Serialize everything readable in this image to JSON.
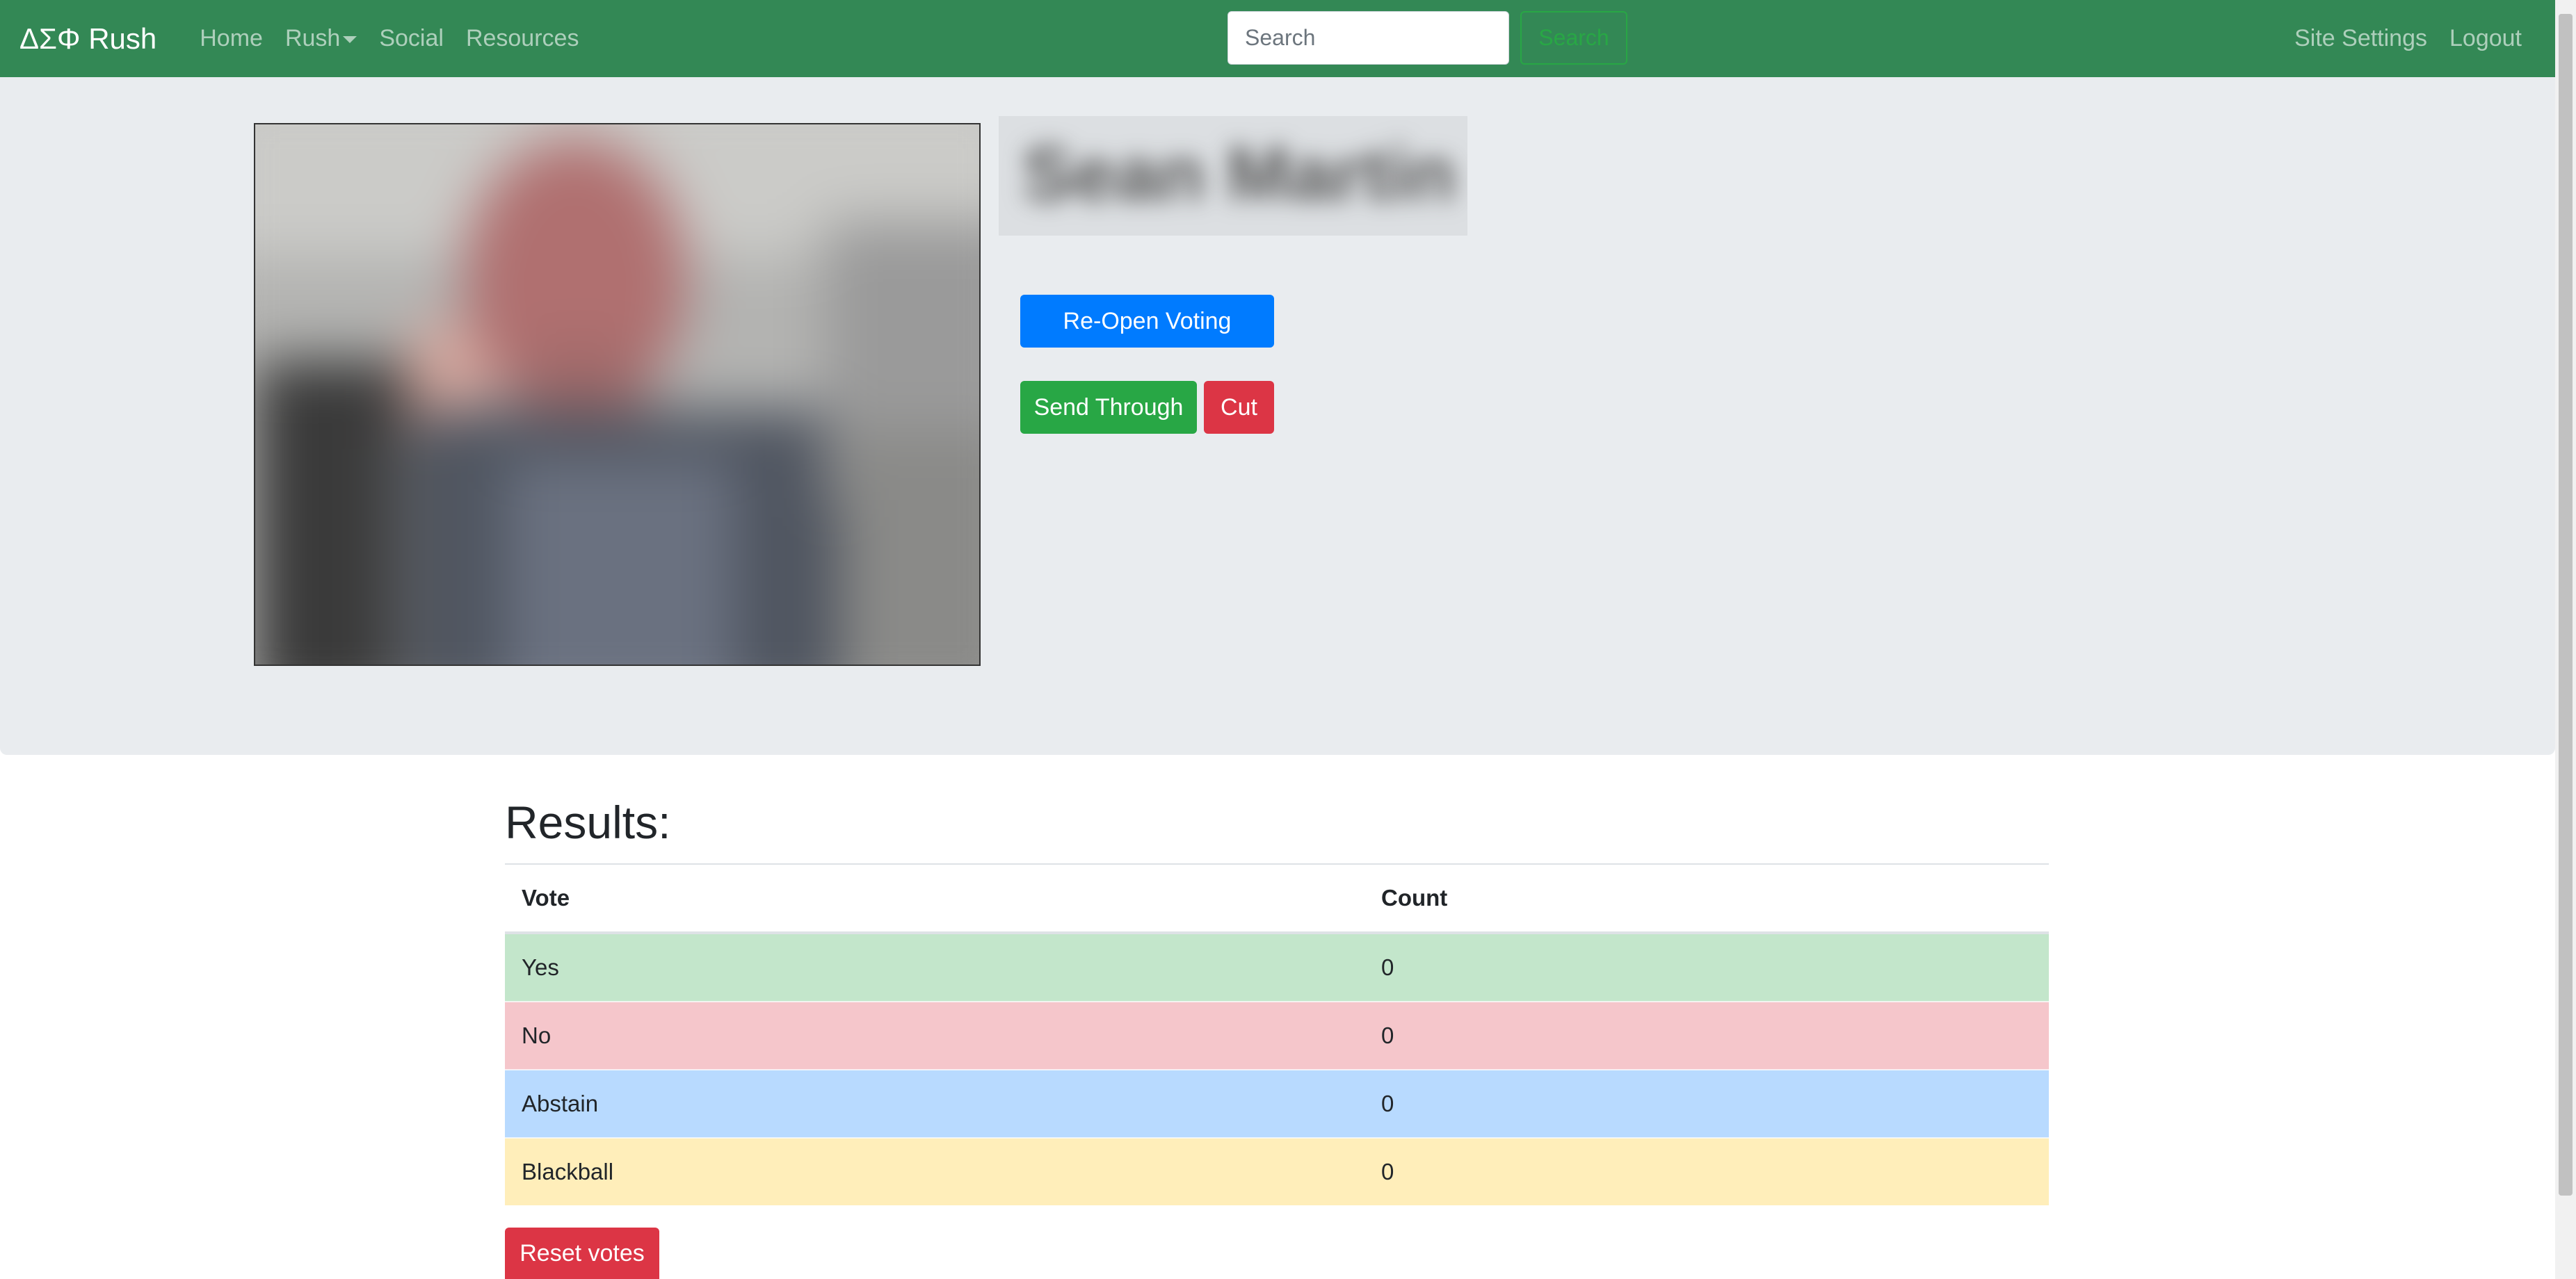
{
  "navbar": {
    "brand": "ΔΣΦ Rush",
    "links": [
      "Home",
      "Rush",
      "Social",
      "Resources"
    ],
    "search_placeholder": "Search",
    "search_button": "Search",
    "right_links": [
      "Site Settings",
      "Logout"
    ]
  },
  "profile": {
    "name": "Sean Martin",
    "photo_alt": "candidate photo (blurred)",
    "buttons": {
      "reopen": "Re-Open Voting",
      "send_through": "Send Through",
      "cut": "Cut"
    }
  },
  "results": {
    "title": "Results:",
    "columns": [
      "Vote",
      "Count"
    ],
    "rows": [
      {
        "vote": "Yes",
        "count": "0"
      },
      {
        "vote": "No",
        "count": "0"
      },
      {
        "vote": "Abstain",
        "count": "0"
      },
      {
        "vote": "Blackball",
        "count": "0"
      }
    ],
    "reset_button": "Reset votes"
  },
  "colors": {
    "navbar": "#338855",
    "primary": "#007bff",
    "success": "#28a745",
    "danger": "#dc3545"
  }
}
